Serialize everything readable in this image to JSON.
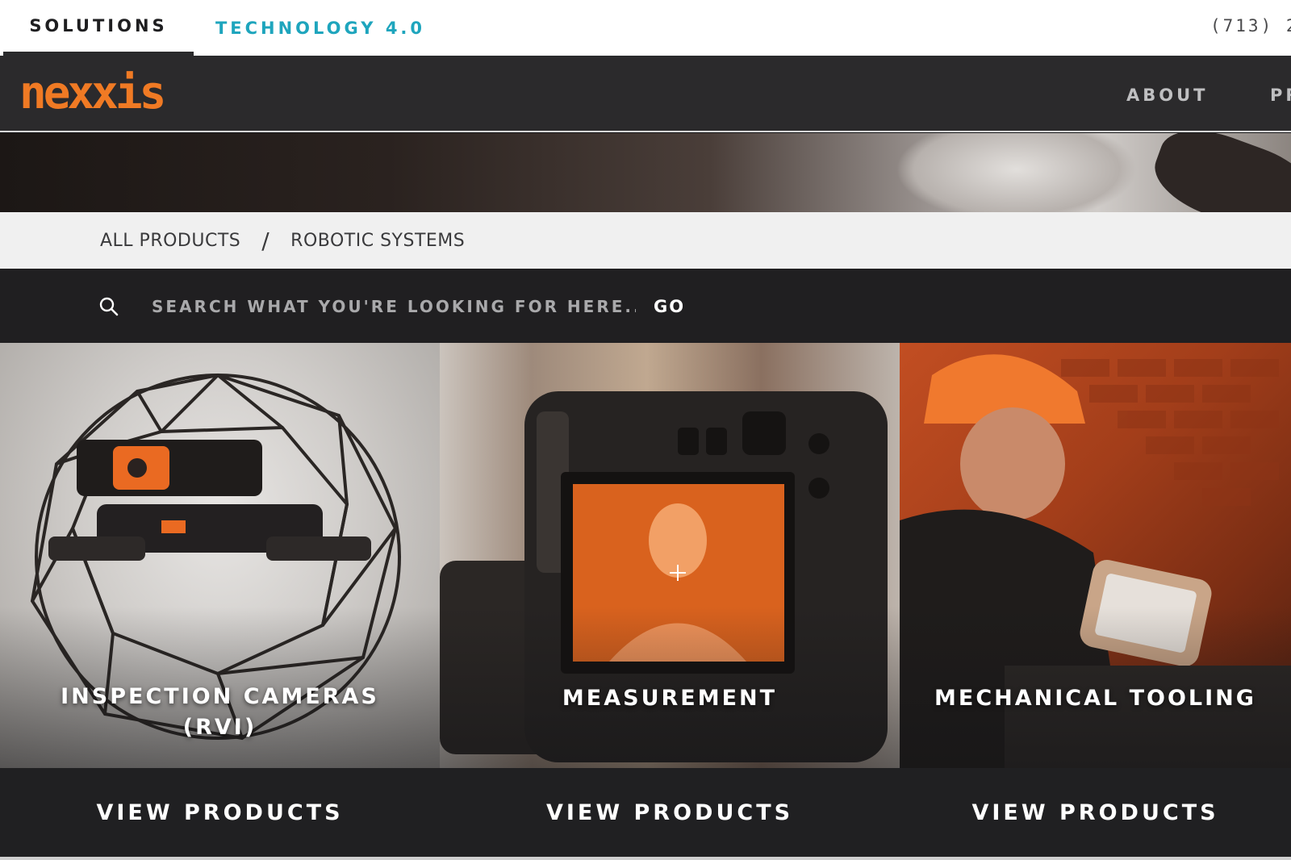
{
  "topbar": {
    "tabs": [
      {
        "label": "SOLUTIONS"
      },
      {
        "label": "TECHNOLOGY 4.0"
      }
    ],
    "phone": "(713) 2"
  },
  "nav": {
    "logo": "nexxis",
    "links": [
      {
        "label": "ABOUT"
      },
      {
        "label": "PR"
      }
    ]
  },
  "breadcrumb": {
    "items": [
      {
        "label": "ALL PRODUCTS"
      },
      {
        "label": "ROBOTIC SYSTEMS"
      }
    ],
    "separator": "/"
  },
  "search": {
    "placeholder": "SEARCH WHAT YOU'RE LOOKING FOR HERE....",
    "go_label": "GO",
    "icon": "search-icon"
  },
  "cards": [
    {
      "title_line1": "INSPECTION CAMERAS",
      "title_line2": "(RVI)",
      "button": "VIEW PRODUCTS"
    },
    {
      "title_line1": "MEASUREMENT",
      "button": "VIEW PRODUCTS"
    },
    {
      "title_line1": "MECHANICAL TOOLING",
      "button": "VIEW PRODUCTS"
    }
  ],
  "colors": {
    "brand_orange": "#f07a24",
    "accent_teal": "#1ea5bd",
    "nav_bg": "#2b2a2c",
    "search_bg": "#201f21"
  }
}
